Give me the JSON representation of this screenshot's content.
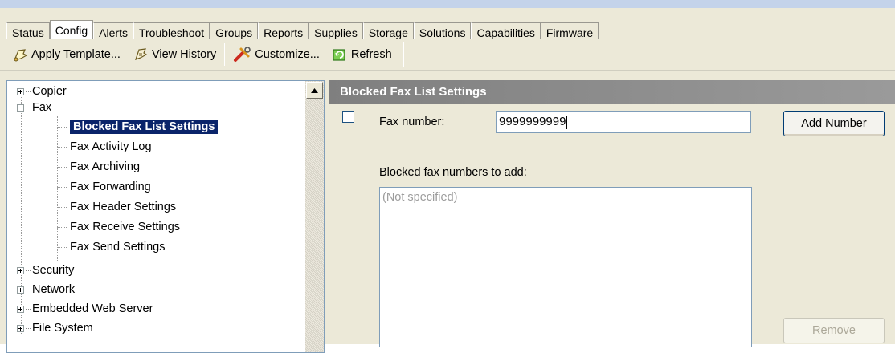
{
  "tabs": [
    "Status",
    "Config",
    "Alerts",
    "Troubleshoot",
    "Groups",
    "Reports",
    "Supplies",
    "Storage",
    "Solutions",
    "Capabilities",
    "Firmware"
  ],
  "active_tab": "Config",
  "toolbar": {
    "apply_template": "Apply Template...",
    "view_history": "View History",
    "customize": "Customize...",
    "refresh": "Refresh"
  },
  "tree": {
    "copier": "Copier",
    "fax": "Fax",
    "fax_children": [
      "Blocked Fax List Settings",
      "Fax Activity Log",
      "Fax Archiving",
      "Fax Forwarding",
      "Fax Header Settings",
      "Fax Receive Settings",
      "Fax Send Settings"
    ],
    "security": "Security",
    "network": "Network",
    "embedded_web_server": "Embedded Web Server",
    "file_system": "File System"
  },
  "panel": {
    "title": "Blocked Fax List Settings",
    "fax_number_label": "Fax number:",
    "fax_number_value": "9999999999",
    "add_button": "Add Number",
    "blocked_label": "Blocked fax numbers to add:",
    "list_placeholder": "(Not specified)",
    "remove_button": "Remove"
  }
}
